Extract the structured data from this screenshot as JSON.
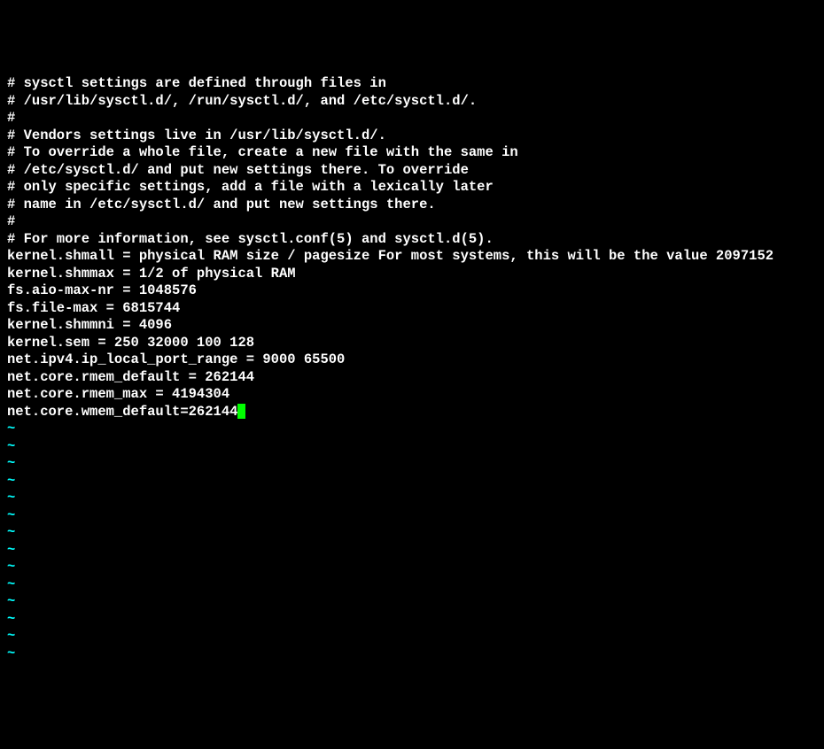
{
  "lines": [
    "# sysctl settings are defined through files in",
    "# /usr/lib/sysctl.d/, /run/sysctl.d/, and /etc/sysctl.d/.",
    "#",
    "# Vendors settings live in /usr/lib/sysctl.d/.",
    "# To override a whole file, create a new file with the same in",
    "# /etc/sysctl.d/ and put new settings there. To override",
    "# only specific settings, add a file with a lexically later",
    "# name in /etc/sysctl.d/ and put new settings there.",
    "#",
    "# For more information, see sysctl.conf(5) and sysctl.d(5).",
    "kernel.shmall = physical RAM size / pagesize For most systems, this will be the value 2097152",
    "kernel.shmmax = 1/2 of physical RAM",
    "fs.aio-max-nr = 1048576",
    "fs.file-max = 6815744",
    "kernel.shmmni = 4096",
    "kernel.sem = 250 32000 100 128",
    "net.ipv4.ip_local_port_range = 9000 65500",
    "net.core.rmem_default = 262144",
    "net.core.rmem_max = 4194304",
    "net.core.wmem_default=262144"
  ],
  "empty_tilde_lines": 14,
  "tilde_char": "~"
}
